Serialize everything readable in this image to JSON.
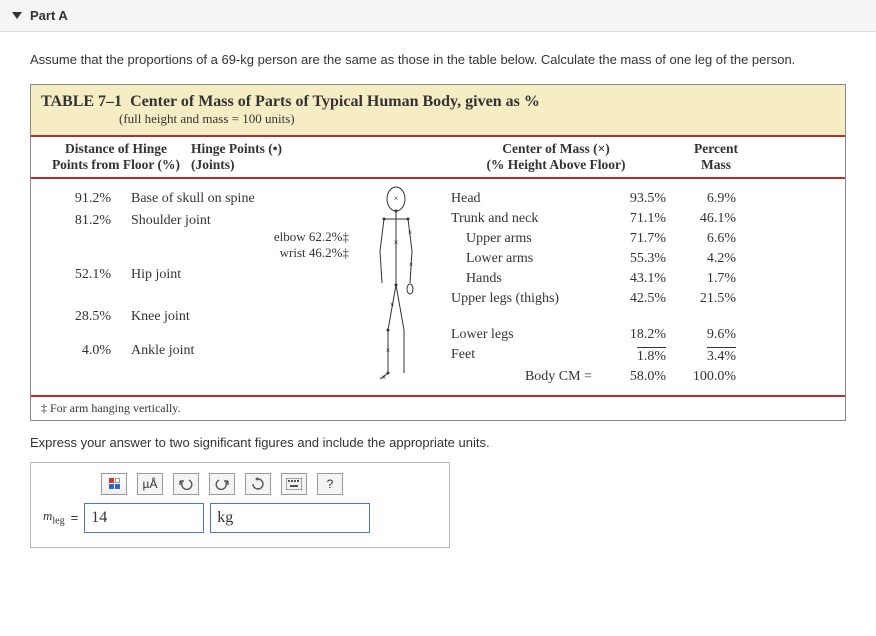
{
  "section": {
    "label": "Part A"
  },
  "prompt": "Assume that the proportions of a 69-kg person are the same as those in the table below. Calculate the mass of one leg of the person.",
  "table": {
    "caption_prefix": "TABLE 7–1",
    "caption_main": "Center of Mass of Parts of Typical Human Body, given as %",
    "caption_sub": "(full height and mass = 100 units)",
    "headers": {
      "hinge_dist1": "Distance of Hinge",
      "hinge_dist2": "Points from Floor (%)",
      "hinge_pts1": "Hinge Points (•)",
      "hinge_pts2": "(Joints)",
      "com1": "Center of Mass (×)",
      "com2": "(% Height Above Floor)",
      "pm1": "Percent",
      "pm2": "Mass"
    },
    "hinge_rows": [
      {
        "pct": "91.2%",
        "name": "Base of skull on spine"
      },
      {
        "pct": "81.2%",
        "name": "Shoulder joint"
      },
      {
        "pct": "52.1%",
        "name": "Hip joint"
      },
      {
        "pct": "28.5%",
        "name": "Knee joint"
      },
      {
        "pct": "4.0%",
        "name": "Ankle joint"
      }
    ],
    "arm_annot": {
      "elbow": "elbow 62.2%‡",
      "wrist": "wrist 46.2%‡"
    },
    "com_rows": [
      {
        "name": "Head",
        "pct": "93.5%",
        "pm": "6.9%",
        "indent": false
      },
      {
        "name": "Trunk and neck",
        "pct": "71.1%",
        "pm": "46.1%",
        "indent": false
      },
      {
        "name": "Upper arms",
        "pct": "71.7%",
        "pm": "6.6%",
        "indent": true
      },
      {
        "name": "Lower arms",
        "pct": "55.3%",
        "pm": "4.2%",
        "indent": true
      },
      {
        "name": "Hands",
        "pct": "43.1%",
        "pm": "1.7%",
        "indent": true
      },
      {
        "name": "Upper legs (thighs)",
        "pct": "42.5%",
        "pm": "21.5%",
        "indent": false
      },
      {
        "name": "Lower legs",
        "pct": "18.2%",
        "pm": "9.6%",
        "indent": false
      },
      {
        "name": "Feet",
        "pct": "1.8%",
        "pm": "3.4%",
        "indent": false
      }
    ],
    "totals": {
      "label": "Body CM =",
      "pct": "58.0%",
      "pm": "100.0%"
    },
    "footnote": "‡ For arm hanging vertically."
  },
  "instruction": "Express your answer to two significant figures and include the appropriate units.",
  "toolbar": {
    "units": "µÅ",
    "help": "?"
  },
  "answer": {
    "variable": "m",
    "subscript": "leg",
    "equals": "=",
    "value": "14",
    "unit": "kg"
  },
  "chart_data": {
    "type": "table",
    "title": "Center of Mass of Parts of Typical Human Body, given as %",
    "hinge_points": [
      {
        "joint": "Base of skull on spine",
        "distance_from_floor_pct": 91.2
      },
      {
        "joint": "Shoulder joint",
        "distance_from_floor_pct": 81.2
      },
      {
        "joint": "Elbow (arm vertical)",
        "distance_from_floor_pct": 62.2
      },
      {
        "joint": "Hip joint",
        "distance_from_floor_pct": 52.1
      },
      {
        "joint": "Wrist (arm vertical)",
        "distance_from_floor_pct": 46.2
      },
      {
        "joint": "Knee joint",
        "distance_from_floor_pct": 28.5
      },
      {
        "joint": "Ankle joint",
        "distance_from_floor_pct": 4.0
      }
    ],
    "center_of_mass": [
      {
        "part": "Head",
        "height_above_floor_pct": 93.5,
        "percent_mass": 6.9
      },
      {
        "part": "Trunk and neck",
        "height_above_floor_pct": 71.1,
        "percent_mass": 46.1
      },
      {
        "part": "Upper arms",
        "height_above_floor_pct": 71.7,
        "percent_mass": 6.6
      },
      {
        "part": "Lower arms",
        "height_above_floor_pct": 55.3,
        "percent_mass": 4.2
      },
      {
        "part": "Hands",
        "height_above_floor_pct": 43.1,
        "percent_mass": 1.7
      },
      {
        "part": "Upper legs (thighs)",
        "height_above_floor_pct": 42.5,
        "percent_mass": 21.5
      },
      {
        "part": "Lower legs",
        "height_above_floor_pct": 18.2,
        "percent_mass": 9.6
      },
      {
        "part": "Feet",
        "height_above_floor_pct": 1.8,
        "percent_mass": 3.4
      }
    ],
    "body_cm_height_pct": 58.0,
    "total_percent_mass": 100.0
  }
}
